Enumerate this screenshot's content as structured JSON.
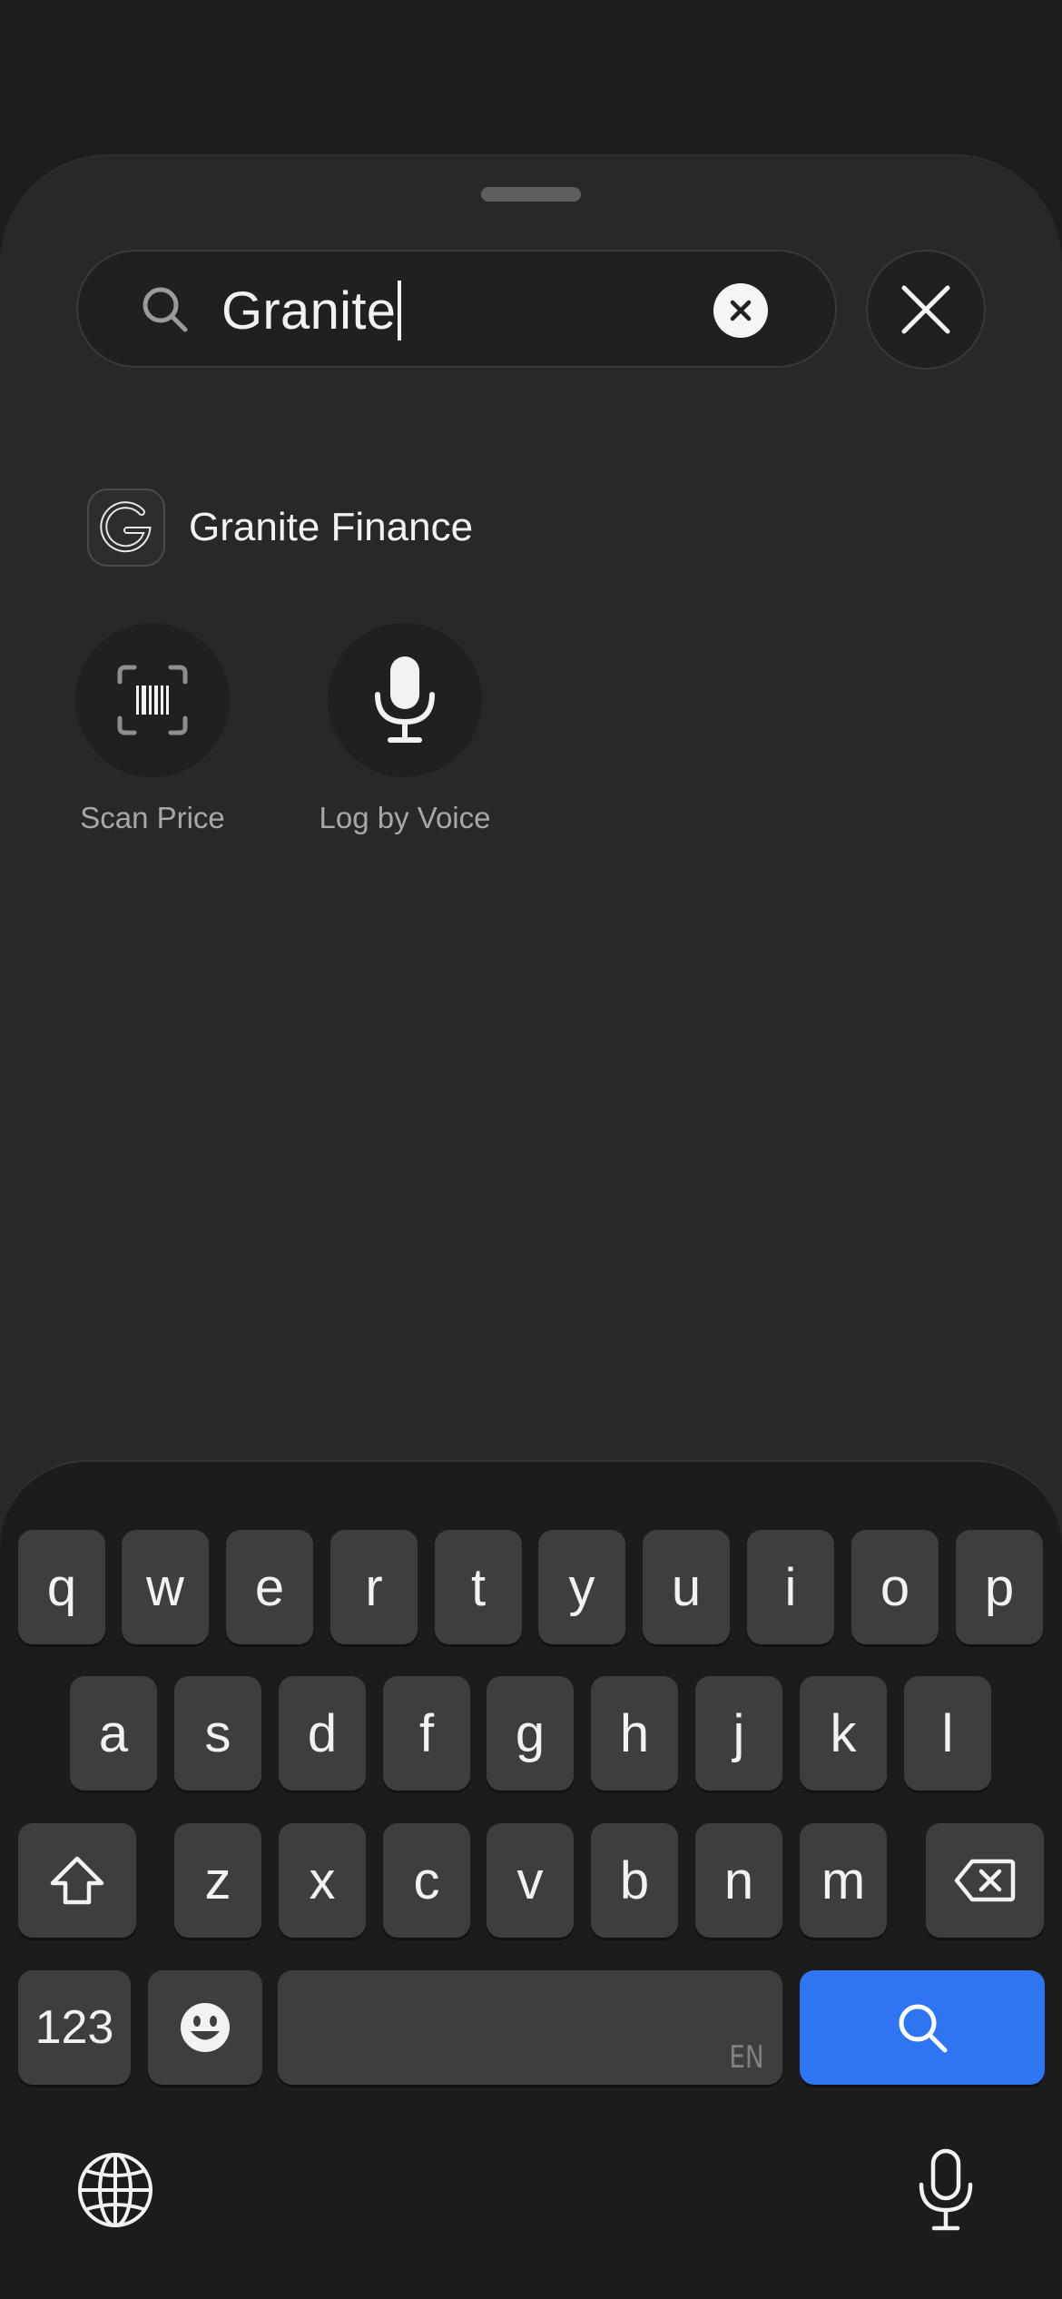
{
  "search": {
    "query": "Granite"
  },
  "results": [
    {
      "label": "Granite Finance",
      "icon": "granite-g-logo"
    }
  ],
  "actions": [
    {
      "label": "Scan Price",
      "icon": "barcode-scan-icon"
    },
    {
      "label": "Log by Voice",
      "icon": "microphone-icon"
    }
  ],
  "keyboard": {
    "row1": [
      "q",
      "w",
      "e",
      "r",
      "t",
      "y",
      "u",
      "i",
      "o",
      "p"
    ],
    "row2": [
      "a",
      "s",
      "d",
      "f",
      "g",
      "h",
      "j",
      "k",
      "l"
    ],
    "row3": [
      "z",
      "x",
      "c",
      "v",
      "b",
      "n",
      "m"
    ],
    "numbers_label": "123",
    "space_language": "EN"
  },
  "colors": {
    "accent": "#2f74f0",
    "sheet": "#272928",
    "key": "#3d3f3e"
  }
}
